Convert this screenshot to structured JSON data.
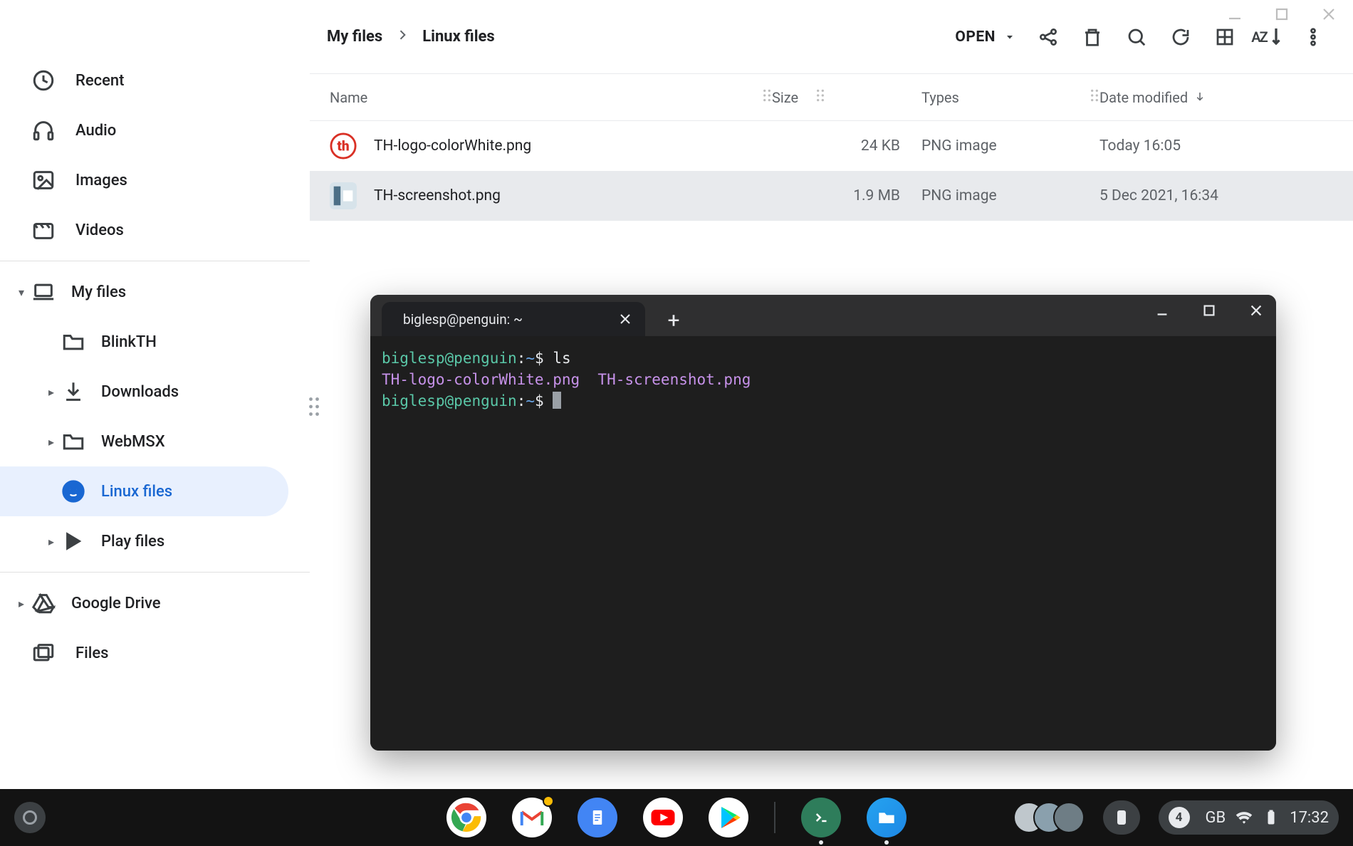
{
  "window_controls": {
    "minimize": "minimize",
    "maximize": "maximize",
    "close": "close"
  },
  "sidebar": {
    "quick": [
      {
        "id": "recent",
        "label": "Recent"
      },
      {
        "id": "audio",
        "label": "Audio"
      },
      {
        "id": "images",
        "label": "Images"
      },
      {
        "id": "videos",
        "label": "Videos"
      }
    ],
    "myfiles_label": "My files",
    "myfiles_children": [
      {
        "id": "blinkth",
        "label": "BlinkTH",
        "expandable": false
      },
      {
        "id": "downloads",
        "label": "Downloads",
        "expandable": true
      },
      {
        "id": "webmsx",
        "label": "WebMSX",
        "expandable": true
      },
      {
        "id": "linux",
        "label": "Linux files",
        "expandable": false,
        "active": true
      },
      {
        "id": "play",
        "label": "Play files",
        "expandable": true
      }
    ],
    "gdrive_label": "Google Drive",
    "files_label": "Files"
  },
  "toolbar": {
    "breadcrumb": [
      "My files",
      "Linux files"
    ],
    "open_label": "OPEN",
    "icons": [
      "share-icon",
      "trash-icon",
      "search-icon",
      "refresh-icon",
      "grid-view-icon",
      "sort-az-icon",
      "more-vert-icon"
    ]
  },
  "columns": {
    "name": "Name",
    "size": "Size",
    "type": "Types",
    "date": "Date modified"
  },
  "files": [
    {
      "name": "TH-logo-colorWhite.png",
      "size": "24 KB",
      "type": "PNG image",
      "date": "Today 16:05",
      "selected": false,
      "thumb": "th-logo"
    },
    {
      "name": "TH-screenshot.png",
      "size": "1.9 MB",
      "type": "PNG image",
      "date": "5 Dec 2021, 16:34",
      "selected": true,
      "thumb": "th-shot"
    }
  ],
  "terminal": {
    "tab_title": "biglesp@penguin: ~",
    "lines": [
      {
        "prompt": {
          "user": "biglesp",
          "host": "penguin",
          "cwd": "~",
          "sep1": "@",
          "sep2": ":",
          "dollar": "$"
        },
        "cmd": "ls"
      },
      {
        "output": "TH-logo-colorWhite.png  TH-screenshot.png"
      },
      {
        "prompt": {
          "user": "biglesp",
          "host": "penguin",
          "cwd": "~",
          "sep1": "@",
          "sep2": ":",
          "dollar": "$"
        },
        "cmd": ""
      }
    ]
  },
  "shelf": {
    "apps": [
      "chrome",
      "gmail",
      "docs",
      "youtube",
      "play-store"
    ],
    "apps_running": [
      "terminal",
      "files"
    ],
    "status": {
      "ram_badge": "4",
      "ram_label": "GB",
      "time": "17:32"
    }
  }
}
